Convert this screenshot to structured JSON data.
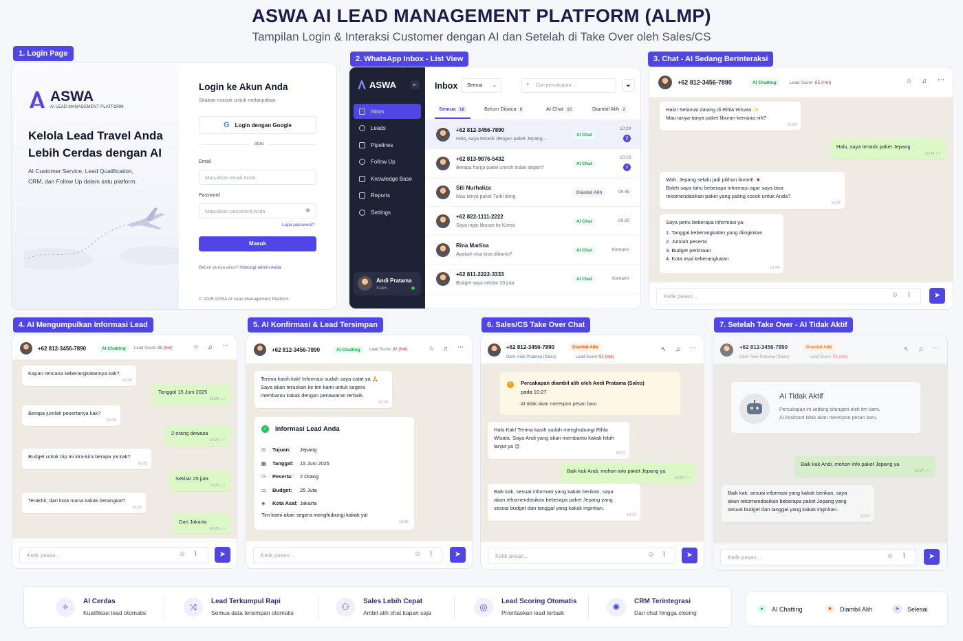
{
  "header": {
    "title": "ASWA AI LEAD MANAGEMENT PLATFORM (ALMP)",
    "subtitle": "Tampilan Login & Interaksi Customer dengan AI dan Setelah di Take Over oleh Sales/CS"
  },
  "tags": [
    "1. Login Page",
    "2. WhatsApp Inbox - List View",
    "3. Chat - AI Sedang Berinteraksi",
    "4. AI Mengumpulkan Informasi Lead",
    "5. AI Konfirmasi & Lead Tersimpan",
    "6. Sales/CS Take Over Chat",
    "7. Setelah Take Over - AI Tidak Aktif"
  ],
  "login": {
    "brand": "ASWA",
    "brand_sub": "AI LEAD MANAGEMENT PLATFORM",
    "headline1": "Kelola Lead Travel Anda",
    "headline2": "Lebih Cerdas dengan AI",
    "desc1": "AI Customer Service, Lead Qualification,",
    "desc2": "CRM, dan Follow Up dalam satu platform.",
    "title": "Login ke Akun Anda",
    "subtitle": "Silakan masuk untuk melanjutkan",
    "google": "Login dengan Google",
    "or": "atau",
    "email_label": "Email",
    "email_ph": "Masukkan email Anda",
    "pw_label": "Password",
    "pw_ph": "Masukkan password Anda",
    "forgot": "Lupa password?",
    "submit": "Masuk",
    "signup_q": "Belum punya akun?",
    "signup_link": "Hubungi admin Anda",
    "footer": "© 2025 ASWA AI Lead Management Platform"
  },
  "inbox": {
    "brand": "ASWA",
    "title": "Inbox",
    "filter": "Semua",
    "search_ph": "Cari percakapan...",
    "menu": [
      "Inbox",
      "Leads",
      "Pipelines",
      "Follow Up",
      "Knowledge Base",
      "Reports",
      "Settings"
    ],
    "user": {
      "name": "Andi Pratama",
      "role": "Sales"
    },
    "tabs": [
      {
        "label": "Semua",
        "count": "18"
      },
      {
        "label": "Belum Dibaca",
        "count": "6"
      },
      {
        "label": "AI Chat",
        "count": "10"
      },
      {
        "label": "Diambil Alih",
        "count": "2"
      }
    ],
    "rows": [
      {
        "name": "+62 812-3456-7890",
        "msg": "Halo, saya tertarik dengan paket Jepang...",
        "status": "AI Chat",
        "time": "10:24",
        "unread": "2"
      },
      {
        "name": "+62 813-9876-5432",
        "msg": "Berapa harga paket umroh bulan depan?",
        "status": "AI Chat",
        "time": "10:15",
        "unread": "1"
      },
      {
        "name": "Siti Nurhaliza",
        "msg": "Mau tanya paket Turki dong",
        "status": "Diambil Alih",
        "time": "09:48",
        "unread": ""
      },
      {
        "name": "+62 822-1111-2222",
        "msg": "Saya ingin liburan ke Korea",
        "status": "AI Chat",
        "time": "09:30",
        "unread": ""
      },
      {
        "name": "Rina Marlina",
        "msg": "Apakah visa bisa dibantu?",
        "status": "AI Chat",
        "time": "Kemarin",
        "unread": ""
      },
      {
        "name": "+62 811-2222-3333",
        "msg": "Budget saya sekitar 20 juta",
        "status": "AI Chat",
        "time": "Kemarin",
        "unread": ""
      }
    ]
  },
  "chat_common": {
    "phone": "+62 812-3456-7890",
    "ai_status": "AI Chatting",
    "taken_status": "Diambil Alih",
    "lead_score_label": "Lead Score:",
    "lead_score": "85 (Hot)",
    "lead_score2": "92 (Hot)",
    "taken_by": "Oleh: Andi Pratama (Sales)",
    "input_ph": "Ketik pesan..."
  },
  "chat3": [
    {
      "text": "Halo! Selamat datang di Rihla Wisata ✨\nMau tanya-tanya paket liburan kemana nih?",
      "time": "10:24"
    },
    {
      "text": "Halo, saya tertarik paket Jepang",
      "time": "10:24 ✓✓"
    },
    {
      "text": "Wah, Jepang selalu jadi pilihan favorit! 🇯🇵\nBoleh saya tahu beberapa informasi agar saya bisa\nrekomendasikan paket yang paling cocok untuk Anda?",
      "time": "10:24"
    },
    {
      "text": "Saya perlu beberapa informasi ya:",
      "time": "10:24",
      "items": [
        "1.  Tanggal keberangkatan yang diinginkan",
        "2.  Jumlah peserta",
        "3.  Budget perkiraan",
        "4.  Kota asal keberangkatan"
      ]
    }
  ],
  "chat4": [
    {
      "text": "Kapan rencana keberangkatannya kak?",
      "time": "10:25"
    },
    {
      "text": "Tanggal 15 Juni 2025",
      "time": "10:25 ✓✓"
    },
    {
      "text": "Berapa jumlah pesertanya kak?",
      "time": "10:25"
    },
    {
      "text": "2 orang dewasa",
      "time": "10:25 ✓✓"
    },
    {
      "text": "Budget untuk trip ini kira-kira berapa ya kak?",
      "time": "10:25"
    },
    {
      "text": "Sekitar 25 juta",
      "time": "10:25 ✓✓"
    },
    {
      "text": "Terakhir, dari kota mana kakak berangkat?",
      "time": "10:25"
    },
    {
      "text": "Dari Jakarta",
      "time": "10:25 ✓✓"
    }
  ],
  "chat5": {
    "msg": "Terima kasih kak! Informasi sudah saya catat ya 🙏\nSaya akan teruskan ke tim kami untuk segera\nmembantu kakak dengan penawaran terbaik.",
    "msg_time": "10:26",
    "card_title": "Informasi Lead Anda",
    "fields": [
      {
        "k": "Tujuan:",
        "v": "Jepang"
      },
      {
        "k": "Tanggal:",
        "v": "15 Juni 2025"
      },
      {
        "k": "Peserta:",
        "v": "2 Orang"
      },
      {
        "k": "Budget:",
        "v": "25 Juta"
      },
      {
        "k": "Kota Asal:",
        "v": "Jakarta"
      }
    ],
    "card_footer": "Tim kami akan segera menghubungi kakak ya!",
    "card_time": "10:26"
  },
  "chat6": {
    "notice_title": "Percakapan diambil alih oleh Andi Pratama (Sales)",
    "notice_time": "pada 10:27",
    "notice_sub": "AI tidak akan merespon pesan baru",
    "m1": "Halo Kak! Terima kasih sudah menghubungi Rihla\nWisata. Saya Andi yang akan membantu kakak lebih\nlanjut ya 😊",
    "m1_time": "10:27",
    "m2": "Baik kak Andi, mohon info paket Jepang ya",
    "m2_time": "10:27 ✓✓",
    "m3": "Baik kak, sesuai informasi yang kakak berikan, saya\nakan rekomendasikan beberapa paket Jepang yang\nsesuai budget dan tanggal yang kakak inginkan.",
    "m3_time": "10:27"
  },
  "chat7": {
    "card_title": "AI Tidak Aktif",
    "card_sub1": "Percakapan ini sedang ditangani oleh tim kami.",
    "card_sub2": "AI Assistant tidak akan merespon pesan baru.",
    "m1": "Baik kak Andi, mohon info paket Jepang ya",
    "m1_time": "10:27 ✓✓",
    "m2": "Baik kak, sesuai informasi yang kakak berikan, saya\nakan rekomendasikan beberapa paket Jepang yang\nsesuai budget dan tanggal yang kakak inginkan.",
    "m2_time": "10:27"
  },
  "features": [
    {
      "icon": "sparkle-icon",
      "title": "AI Cerdas",
      "sub": "Kualifikasi lead otomatis"
    },
    {
      "icon": "shuffle-icon",
      "title": "Lead Terkumpul Rapi",
      "sub": "Semua data tersimpan otomatis"
    },
    {
      "icon": "users-icon",
      "title": "Sales Lebih Cepat",
      "sub": "Ambil alih chat kapan saja"
    },
    {
      "icon": "target-icon",
      "title": "Lead Scoring Otomatis",
      "sub": "Prioritaskan lead terbaik"
    },
    {
      "icon": "network-icon",
      "title": "CRM Terintegrasi",
      "sub": "Dari chat hingga closing"
    }
  ],
  "legend": [
    {
      "label": "AI Chatting",
      "color": "#16a34a"
    },
    {
      "label": "Diambil Alih",
      "color": "#ea580c"
    },
    {
      "label": "Selesai",
      "color": "#4f46e5"
    }
  ]
}
